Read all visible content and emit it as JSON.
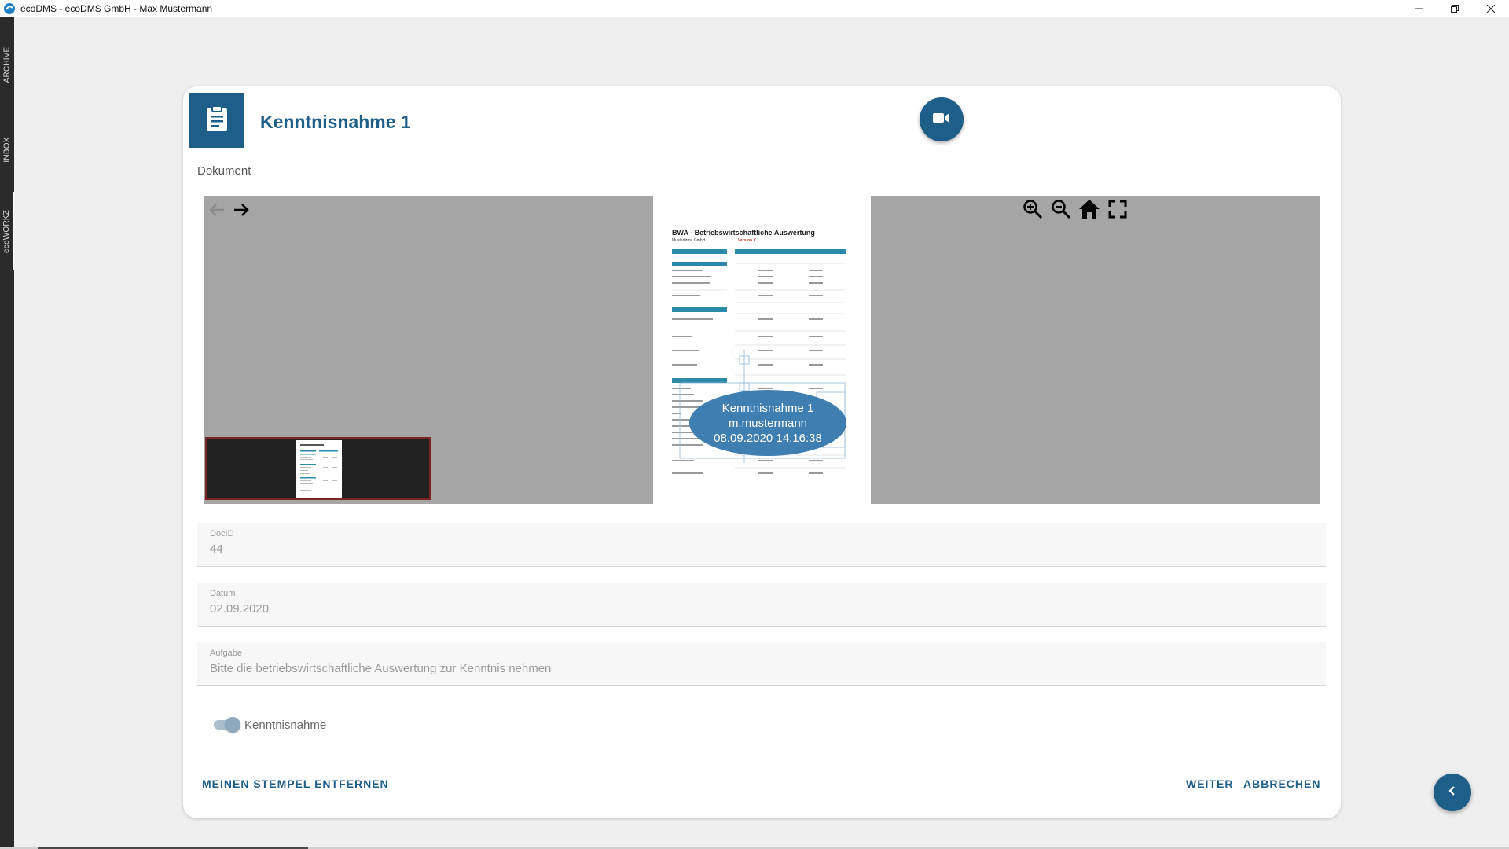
{
  "window": {
    "title": "ecoDMS - ecoDMS GmbH - Max Mustermann",
    "controls": [
      "minimize",
      "restore",
      "close"
    ]
  },
  "sidebar": {
    "tabs": [
      {
        "label": "ARCHIVE",
        "active": false
      },
      {
        "label": "INBOX",
        "active": false
      },
      {
        "label": "ecoWORKZ",
        "active": true
      }
    ]
  },
  "card": {
    "title": "Kenntnisnahme 1",
    "header_icon": "clipboard-icon",
    "video_button_icon": "videocam-icon",
    "section_label": "Dokument"
  },
  "viewer": {
    "tools": [
      "zoom-in-icon",
      "zoom-out-icon",
      "home-icon",
      "fullscreen-icon"
    ],
    "document": {
      "title": "BWA - Betriebswirtschaftliche Auswertung",
      "company": "Musterfirma GmbH",
      "version": "Version X"
    },
    "stamp": {
      "line1": "Kenntnisnahme 1",
      "line2": "m.mustermann",
      "line3": "08.09.2020 14:16:38"
    }
  },
  "fields": {
    "docid": {
      "label": "DocID",
      "value": "44"
    },
    "datum": {
      "label": "Datum",
      "value": "02.09.2020"
    },
    "aufgabe": {
      "label": "Aufgabe",
      "value": "Bitte die betriebswirtschaftliche Auswertung zur Kenntnis nehmen"
    }
  },
  "toggle": {
    "label": "Kenntnisnahme",
    "checked": true
  },
  "actions": {
    "remove_stamp": "MEINEN STEMPEL ENTFERNEN",
    "next": "WEITER",
    "cancel": "ABBRECHEN"
  },
  "colors": {
    "accent": "#1e5f89",
    "stamp": "#3f7eb0",
    "viewer_bg": "#a5a5a5"
  }
}
